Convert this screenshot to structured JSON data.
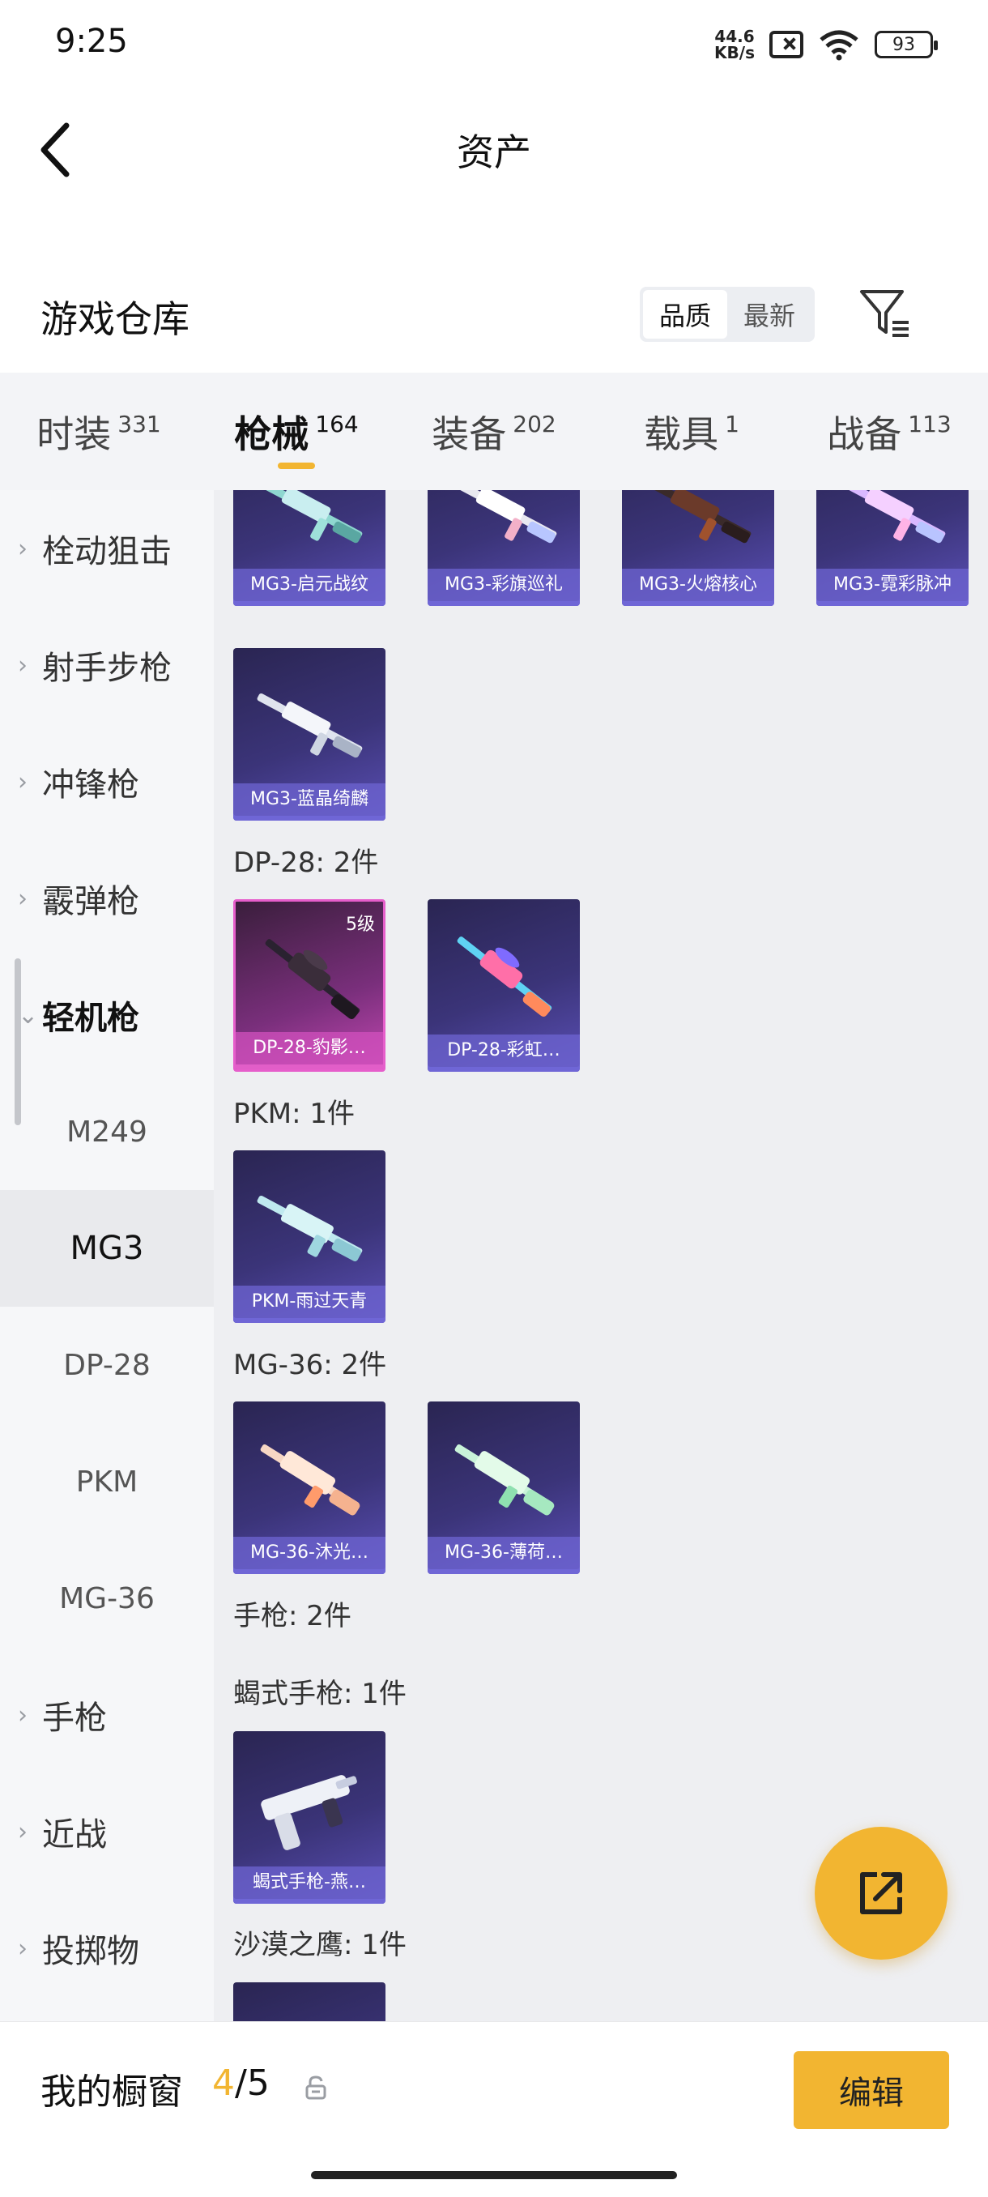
{
  "status": {
    "time": "9:25",
    "net_speed": "44.6",
    "net_unit": "KB/s",
    "battery": "93"
  },
  "header": {
    "title": "资产"
  },
  "section": {
    "title": "游戏仓库",
    "sort_options": [
      "品质",
      "最新"
    ],
    "sort_active": "品质"
  },
  "tabs": [
    {
      "label": "时装",
      "count": "331"
    },
    {
      "label": "枪械",
      "count": "164",
      "active": true
    },
    {
      "label": "装备",
      "count": "202"
    },
    {
      "label": "载具",
      "count": "1"
    },
    {
      "label": "战备",
      "count": "113"
    }
  ],
  "sidebar": {
    "items": [
      "栓动狙击",
      "射手步枪",
      "冲锋枪",
      "霰弹枪",
      "轻机枪",
      "手枪",
      "近战",
      "投掷物"
    ],
    "expanded": "轻机枪",
    "subitems": [
      "M249",
      "MG3",
      "DP-28",
      "PKM",
      "MG-36"
    ],
    "selected_sub": "MG3"
  },
  "content": {
    "mg3_cards": [
      "MG3-启元战纹",
      "MG3-彩旗巡礼",
      "MG3-火熔核心",
      "MG3-霓彩脉冲",
      "MG3-蓝晶绮麟"
    ],
    "dp28_label": "DP-28: 2件",
    "dp28_cards": [
      "DP-28-豹影…",
      "DP-28-彩虹…"
    ],
    "dp28_grade": "5级",
    "pkm_label": "PKM: 1件",
    "pkm_cards": [
      "PKM-雨过天青"
    ],
    "mg36_label": "MG-36: 2件",
    "mg36_cards": [
      "MG-36-沐光…",
      "MG-36-薄荷…"
    ],
    "pistol_label": "手枪: 2件",
    "scorpion_label": "蝎式手枪: 1件",
    "scorpion_cards": [
      "蝎式手枪-燕…"
    ],
    "deagle_label": "沙漠之鹰: 1件"
  },
  "bottom": {
    "window_label": "我的橱窗",
    "window_current": "4",
    "window_total": "/5",
    "edit_label": "编辑"
  },
  "colors": {
    "accent": "#f2b531",
    "card_purple": "#3b3479",
    "card_pink": "#c147b0"
  },
  "icons": {
    "back": "chevron-left-icon",
    "filter": "filter-icon",
    "share": "external-link-icon",
    "lock": "lock-icon"
  }
}
